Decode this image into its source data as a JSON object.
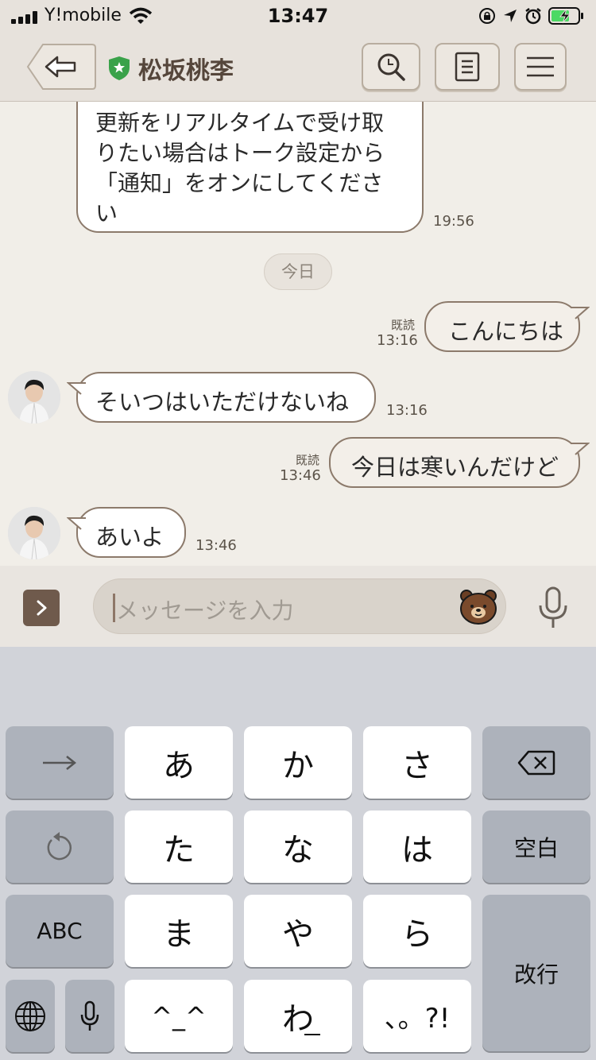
{
  "status_bar": {
    "carrier": "Y!mobile",
    "time": "13:47"
  },
  "header": {
    "contact_name": "松坂桃李"
  },
  "messages": [
    {
      "side": "received",
      "text_lines": [
        "更新をリアルタイムで受け取",
        "りたい場合はトーク設定から",
        "「通知」をオンにしてくださ",
        "い"
      ],
      "time": "19:56"
    },
    {
      "side": "sent",
      "text": "こんにちは",
      "read": "既読",
      "time": "13:16"
    },
    {
      "side": "received",
      "text": "そいつはいただけないね",
      "time": "13:16"
    },
    {
      "side": "sent",
      "text": "今日は寒いんだけど",
      "read": "既読",
      "time": "13:46"
    },
    {
      "side": "received",
      "text": "あいよ",
      "time": "13:46"
    }
  ],
  "date_separator": "今日",
  "input": {
    "placeholder": "メッセージを入力"
  },
  "keyboard": {
    "keys": [
      "あ",
      "か",
      "さ",
      "た",
      "な",
      "は",
      "ま",
      "や",
      "ら",
      "^_^",
      "わ",
      "、。?!"
    ],
    "space": "空白",
    "abc": "ABC",
    "return": "改行"
  },
  "colors": {
    "header_bg": "#e7e2dc",
    "chat_bg": "#f1eee8",
    "bubble_border": "#8c7a6b",
    "title_brown": "#55463b",
    "verified_green": "#3aa24a",
    "keyboard_bg": "#d1d3d9"
  }
}
